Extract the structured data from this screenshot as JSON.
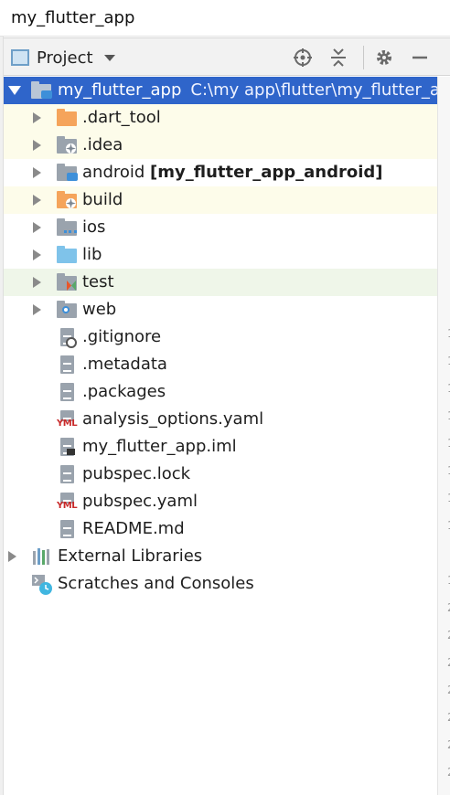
{
  "window": {
    "title": "my_flutter_app"
  },
  "toolbar": {
    "view_label": "Project",
    "buttons": [
      "locate-icon",
      "collapse-all-icon",
      "gear-icon",
      "minimize-icon"
    ]
  },
  "tree": {
    "root": {
      "name": "my_flutter_app",
      "path": "C:\\my app\\flutter\\my_flutter_app"
    },
    "items": [
      {
        "label": ".dart_tool",
        "suffix": "",
        "icon": "folder-orange-icon"
      },
      {
        "label": ".idea",
        "suffix": "",
        "icon": "idea-folder-icon"
      },
      {
        "label": "android",
        "suffix": "[my_flutter_app_android]",
        "icon": "module-folder-icon"
      },
      {
        "label": "build",
        "suffix": "",
        "icon": "excluded-folder-icon"
      },
      {
        "label": "ios",
        "suffix": "",
        "icon": "ios-folder-icon"
      },
      {
        "label": "lib",
        "suffix": "",
        "icon": "source-folder-icon"
      },
      {
        "label": "test",
        "suffix": "",
        "icon": "test-folder-icon"
      },
      {
        "label": "web",
        "suffix": "",
        "icon": "web-folder-icon"
      },
      {
        "label": ".gitignore",
        "suffix": "",
        "icon": "gitignore-file-icon"
      },
      {
        "label": ".metadata",
        "suffix": "",
        "icon": "text-file-icon"
      },
      {
        "label": ".packages",
        "suffix": "",
        "icon": "text-file-icon"
      },
      {
        "label": "analysis_options.yaml",
        "suffix": "",
        "icon": "yaml-file-icon"
      },
      {
        "label": "my_flutter_app.iml",
        "suffix": "",
        "icon": "iml-file-icon"
      },
      {
        "label": "pubspec.lock",
        "suffix": "",
        "icon": "text-file-icon"
      },
      {
        "label": "pubspec.yaml",
        "suffix": "",
        "icon": "yaml-file-icon"
      },
      {
        "label": "README.md",
        "suffix": "",
        "icon": "text-file-icon"
      }
    ],
    "external": {
      "label": "External Libraries",
      "icon": "libraries-icon"
    },
    "scratches": {
      "label": "Scratches and Consoles",
      "icon": "scratches-icon"
    }
  },
  "gutter": {
    "numbers": [
      "1",
      "1",
      "1",
      "1",
      "1",
      "1",
      "1",
      "1",
      "1",
      "2",
      "2",
      "2",
      "2",
      "2",
      "2",
      "2",
      "2"
    ]
  },
  "colors": {
    "selection": "#2f65ca",
    "excluded_bg": "#fdfcea",
    "test_bg": "#eff6e9",
    "accent": "#6e9fc8"
  }
}
